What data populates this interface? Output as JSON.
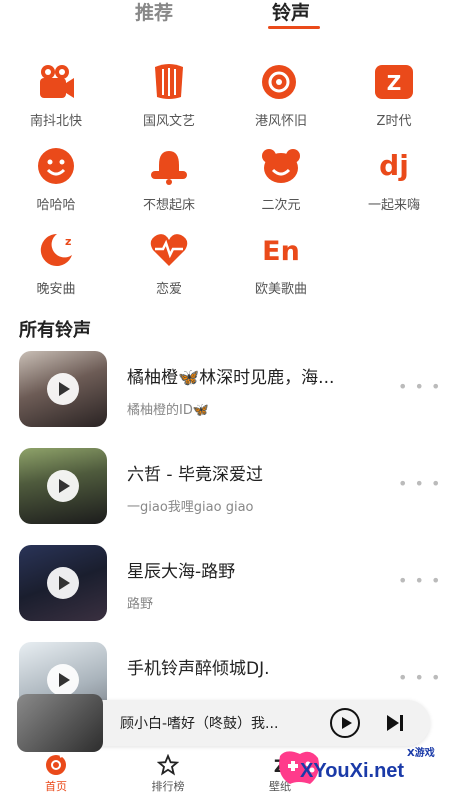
{
  "tabs": {
    "recommend": "推荐",
    "ringtone": "铃声"
  },
  "accent": "#ea4a1a",
  "categories": [
    {
      "label": "南抖北快",
      "icon": "camera-icon"
    },
    {
      "label": "国风文艺",
      "icon": "lyre-icon"
    },
    {
      "label": "港风怀旧",
      "icon": "vinyl-icon"
    },
    {
      "label": "Z时代",
      "icon": "z-icon"
    },
    {
      "label": "哈哈哈",
      "icon": "smile-icon"
    },
    {
      "label": "不想起床",
      "icon": "alarm-bell-icon"
    },
    {
      "label": "二次元",
      "icon": "bear-icon"
    },
    {
      "label": "一起来嗨",
      "icon": "dj-icon"
    },
    {
      "label": "晚安曲",
      "icon": "moon-icon"
    },
    {
      "label": "恋爱",
      "icon": "heartbeat-icon"
    },
    {
      "label": "欧美歌曲",
      "icon": "en-icon"
    }
  ],
  "section_title": "所有铃声",
  "ringtones": [
    {
      "title": "橘柚橙🦋林深时见鹿，海...",
      "artist": "橘柚橙的ID🦋"
    },
    {
      "title": "六哲 - 毕竟深爱过",
      "artist": "一giao我哩giao giao"
    },
    {
      "title": "星辰大海-路野",
      "artist": "路野"
    },
    {
      "title": "手机铃声醉倾城DJ.",
      "artist": ""
    }
  ],
  "more_label": "• • •",
  "player": {
    "title": "顾小白-嗜好（咚鼓）我..."
  },
  "bottom_nav": [
    {
      "label": "首页"
    },
    {
      "label": "排行榜"
    },
    {
      "label": "壁纸"
    }
  ],
  "watermark": {
    "brand": "XYouXi.net",
    "small": "X游戏"
  }
}
